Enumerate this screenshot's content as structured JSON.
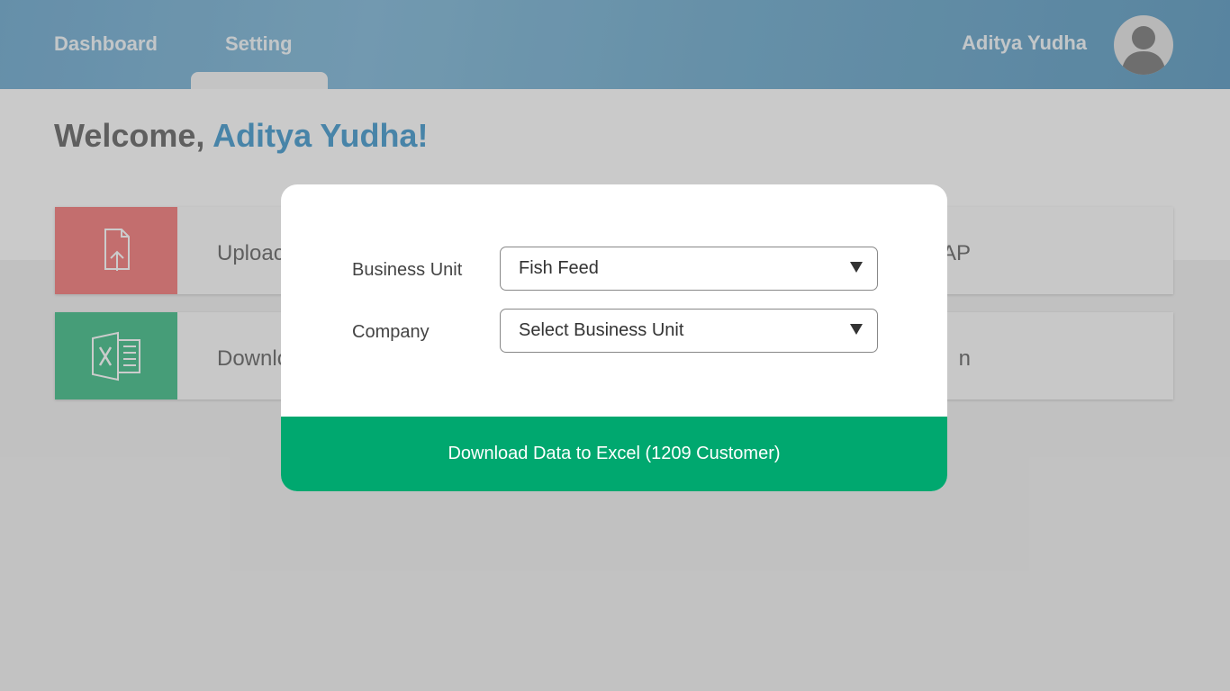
{
  "nav": {
    "items": [
      {
        "label": "Dashboard"
      },
      {
        "label": "Setting"
      }
    ],
    "user_name": "Aditya Yudha"
  },
  "welcome": {
    "prefix": "Welcome, ",
    "name": "Aditya Yudha!"
  },
  "cards": {
    "upload": {
      "label_visible": "Uploac",
      "right_label_visible": "AP"
    },
    "download": {
      "label_visible": "Downlo",
      "right_label_visible": "n"
    }
  },
  "modal": {
    "business_unit_label": "Business Unit",
    "business_unit_value": "Fish Feed",
    "company_label": "Company",
    "company_value": "Select Business Unit",
    "download_button_label": "Download Data to Excel (1209 Customer)"
  },
  "colors": {
    "topbar": "#7fb3d4",
    "accent_blue": "#5aa6d3",
    "upload_card": "#f48a8a",
    "download_card": "#58c596",
    "download_button": "#00a86f"
  }
}
